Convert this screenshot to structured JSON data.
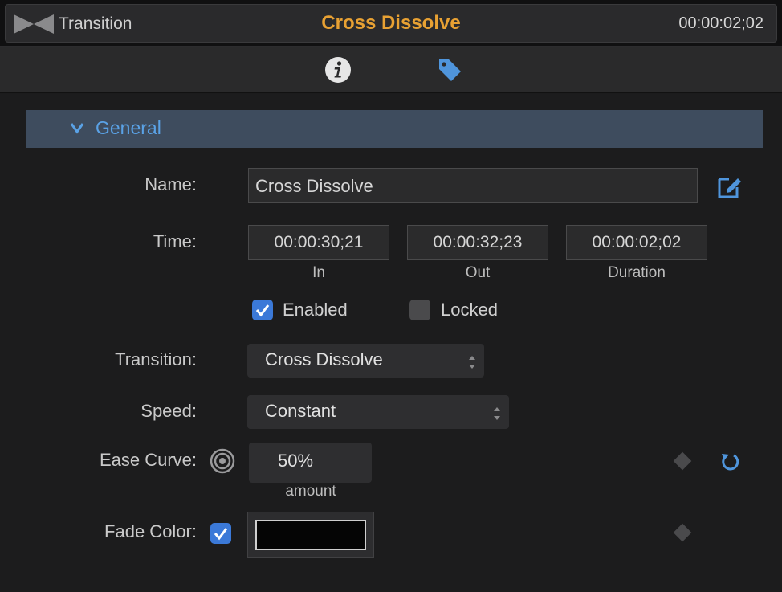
{
  "header": {
    "label": "Transition",
    "title": "Cross Dissolve",
    "timecode": "00:00:02;02",
    "title_color": "#e8a133"
  },
  "tabs": [
    {
      "icon": "info-icon",
      "selected": true
    },
    {
      "icon": "tag-icon",
      "selected": false
    }
  ],
  "section": {
    "title": "General",
    "expanded": true
  },
  "fields": {
    "name_label": "Name:",
    "name_value": "Cross Dissolve",
    "time_label": "Time:",
    "time_in": "00:00:30;21",
    "time_out": "00:00:32;23",
    "time_duration": "00:00:02;02",
    "in_label": "In",
    "out_label": "Out",
    "duration_label": "Duration",
    "enabled_label": "Enabled",
    "enabled_checked": true,
    "locked_label": "Locked",
    "locked_checked": false,
    "transition_label": "Transition:",
    "transition_value": "Cross Dissolve",
    "speed_label": "Speed:",
    "speed_value": "Constant",
    "ease_label": "Ease Curve:",
    "ease_value": "50%",
    "ease_sub": "amount",
    "fade_label": "Fade Color:",
    "fade_checked": true,
    "fade_color": "#050505"
  },
  "colors": {
    "accent": "#3b79d8",
    "section_bg": "#3e4c5e",
    "section_text": "#5aa2e6"
  }
}
